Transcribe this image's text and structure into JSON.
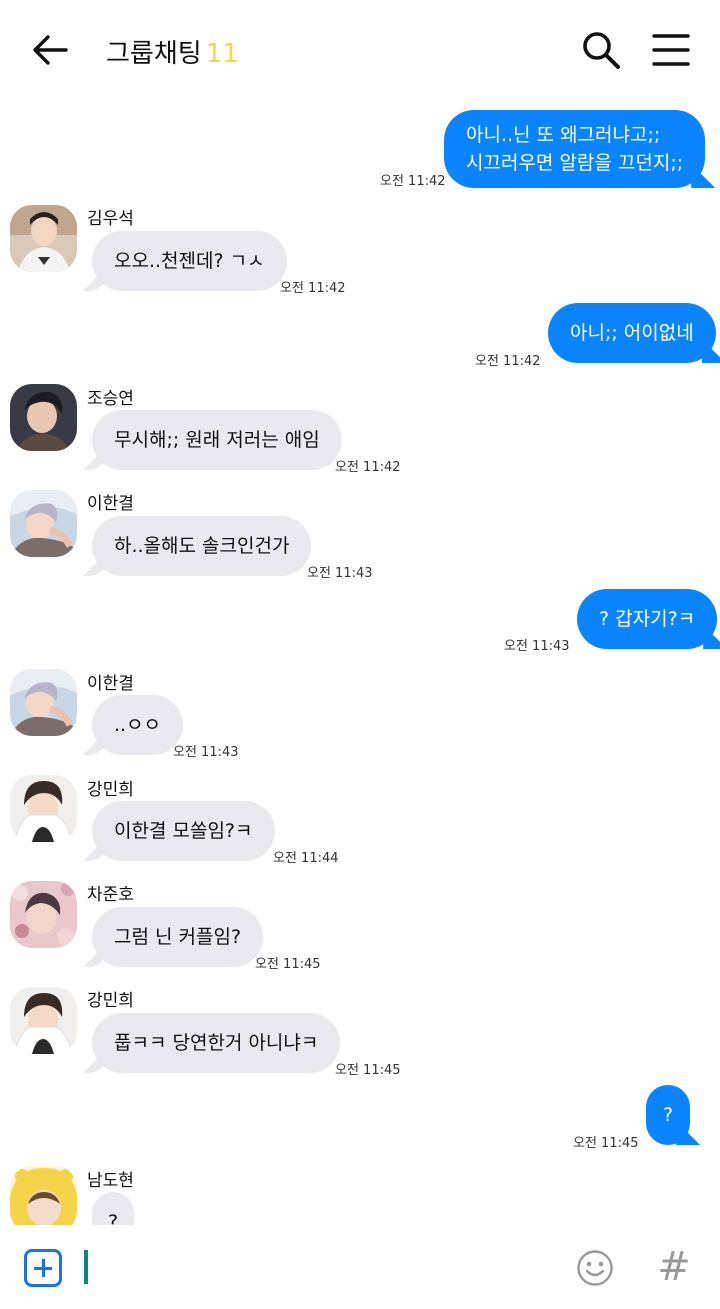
{
  "header": {
    "title": "그룹채팅",
    "member_count": "11",
    "icons": {
      "back": "arrow-left-icon",
      "search": "search-icon",
      "menu": "menu-icon"
    }
  },
  "colors": {
    "accent_blue": "#0a84ff",
    "incoming_bubble": "#e9e9ef",
    "member_count": "#f2dc3c"
  },
  "messages": [
    {
      "from": "me",
      "text_lines": [
        "아니..닌 또 왜그러냐고;;",
        "시끄러우면 알람을 끄던지;;"
      ],
      "time": "오전 11:42"
    },
    {
      "from": "김우석",
      "name": "김우석",
      "text": "오오..천젠데? ㄱㅅ",
      "time": "오전 11:42"
    },
    {
      "from": "me",
      "text": "아니;; 어이없네",
      "time": "오전 11:42"
    },
    {
      "from": "조승연",
      "name": "조승연",
      "text": "무시해;; 원래 저러는 애임",
      "time": "오전 11:42"
    },
    {
      "from": "이한결",
      "name": "이한결",
      "text": "하..올해도 솔크인건가",
      "time": "오전 11:43"
    },
    {
      "from": "me",
      "text": "? 갑자기?ㅋ",
      "time": "오전 11:43"
    },
    {
      "from": "이한결",
      "name": "이한결",
      "text": "..ㅇㅇ",
      "time": "오전 11:43"
    },
    {
      "from": "강민희",
      "name": "강민희",
      "text": "이한결 모쏠임?ㅋ",
      "time": "오전 11:44"
    },
    {
      "from": "차준호",
      "name": "차준호",
      "text": "그럼 닌 커플임?",
      "time": "오전 11:45"
    },
    {
      "from": "강민희",
      "name": "강민희",
      "text": "풉ㅋㅋ 당연한거 아니냐ㅋ",
      "time": "오전 11:45"
    },
    {
      "from": "me",
      "text": "?",
      "time": "오전 11:45"
    },
    {
      "from": "남도현",
      "name": "남도현",
      "text": "?",
      "time": ""
    }
  ],
  "composer": {
    "value": "",
    "icons": {
      "add": "add-box-icon",
      "emoji": "smiley-icon",
      "hashtag": "hashtag-icon"
    },
    "hashtag_glyph": "#"
  }
}
